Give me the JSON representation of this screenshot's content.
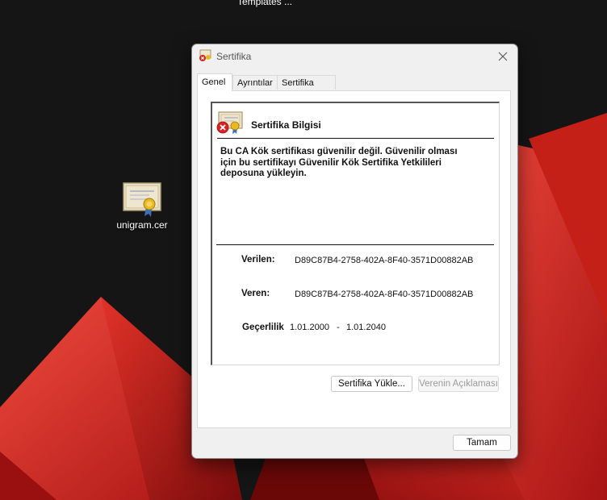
{
  "desktop": {
    "top_label": "Templates ...",
    "file_icon_label": "unigram.cer"
  },
  "dialog": {
    "title": "Sertifika",
    "tabs": [
      {
        "label": "Genel",
        "active": true
      },
      {
        "label": "Ayrıntılar",
        "active": false
      },
      {
        "label": "Sertifika Yolu",
        "active": false
      }
    ],
    "info_heading": "Sertifika Bilgisi",
    "warning_text": "Bu CA Kök sertifikası güvenilir değil. Güvenilir olması için bu sertifikayı Güvenilir Kök Sertifika Yetkilileri deposuna yükleyin.",
    "issued_to_label": "Verilen:",
    "issued_to_value": "D89C87B4-2758-402A-8F40-3571D00882AB",
    "issued_by_label": "Veren:",
    "issued_by_value": "D89C87B4-2758-402A-8F40-3571D00882AB",
    "validity_label": "Geçerlilik",
    "validity_from": "1.01.2000",
    "validity_dash": "-",
    "validity_to": "1.01.2040",
    "install_button": "Sertifika Yükle...",
    "issuer_statement_button": "Verenin Açıklaması",
    "ok_button": "Tamam"
  },
  "colors": {
    "desktop_bg": "#151515",
    "wallpaper_red": "#e8372c",
    "dialog_bg": "#f0f0f0"
  }
}
